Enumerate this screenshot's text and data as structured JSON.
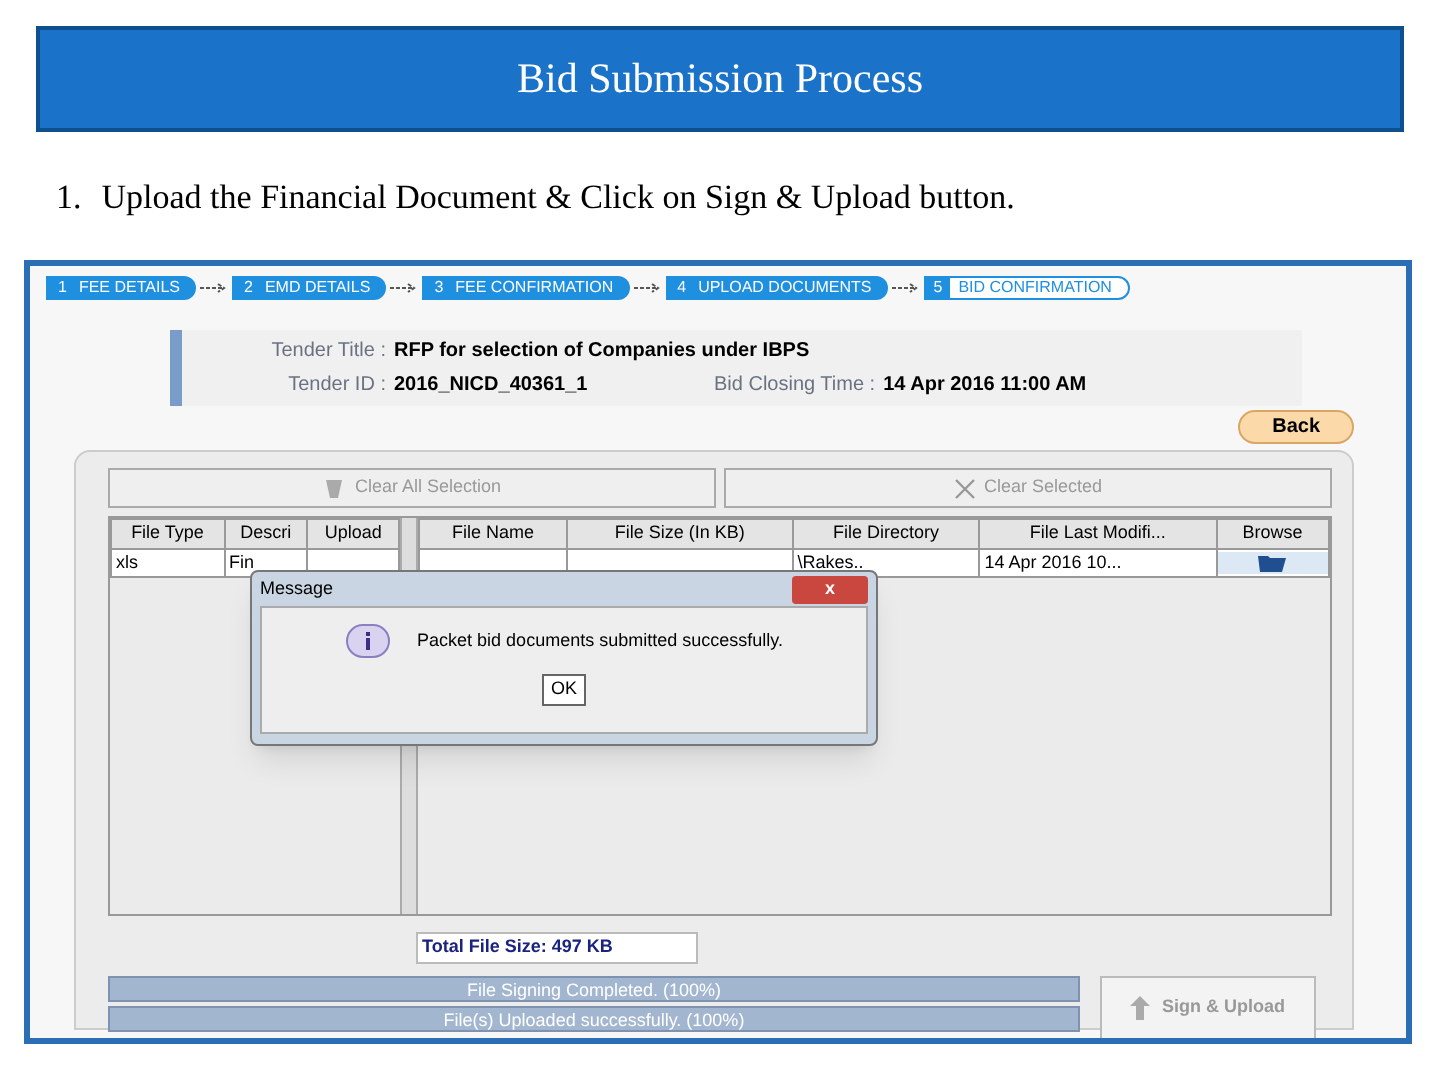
{
  "slide": {
    "title": "Bid Submission Process",
    "step_number": "1.",
    "instruction": "Upload the Financial Document & Click on Sign & Upload button."
  },
  "steps": [
    {
      "number": "1",
      "label": "FEE DETAILS",
      "completed": true
    },
    {
      "number": "2",
      "label": "EMD DETAILS",
      "completed": true
    },
    {
      "number": "3",
      "label": "FEE CONFIRMATION",
      "completed": true
    },
    {
      "number": "4",
      "label": "UPLOAD DOCUMENTS",
      "completed": true
    },
    {
      "number": "5",
      "label": "BID CONFIRMATION",
      "completed": false
    }
  ],
  "tender": {
    "fields": [
      {
        "label": "Tender Title :",
        "value": "RFP for selection of Companies under IBPS"
      },
      {
        "label": "Tender ID :",
        "value": "2016_NICD_40361_1"
      }
    ],
    "closing_label": "Bid Closing Time :",
    "closing_value": "14 Apr 2016 11:00 AM"
  },
  "back_button": "Back",
  "toolbar": [
    {
      "label": "Clear All Selection",
      "disabled": true
    },
    {
      "label": "Clear Selected",
      "disabled": true
    }
  ],
  "left_table": {
    "columns": [
      "File Type",
      "Descri",
      "Upload"
    ],
    "rows": [
      [
        "xls",
        "Fin",
        ""
      ]
    ]
  },
  "right_table": {
    "columns": [
      "File Name",
      "File Size (In KB)",
      "File Directory",
      "File Last Modifi...",
      "Browse"
    ],
    "rows": [
      [
        "",
        "",
        "\\Rakes..",
        "14 Apr 2016 10..."
      ]
    ]
  },
  "total_size": "Total File Size: 497 KB",
  "progress": [
    {
      "text": "File Signing Completed. (100%)",
      "level": 1
    },
    {
      "text": "File(s) Uploaded successfully. (100%)",
      "level": 1
    }
  ],
  "sign_upload": {
    "label": "Sign & Upload",
    "disabled": true
  },
  "dialog": {
    "title": "Message",
    "close": "x",
    "message": "Packet bid documents submitted successfully.",
    "ok": "OK"
  }
}
